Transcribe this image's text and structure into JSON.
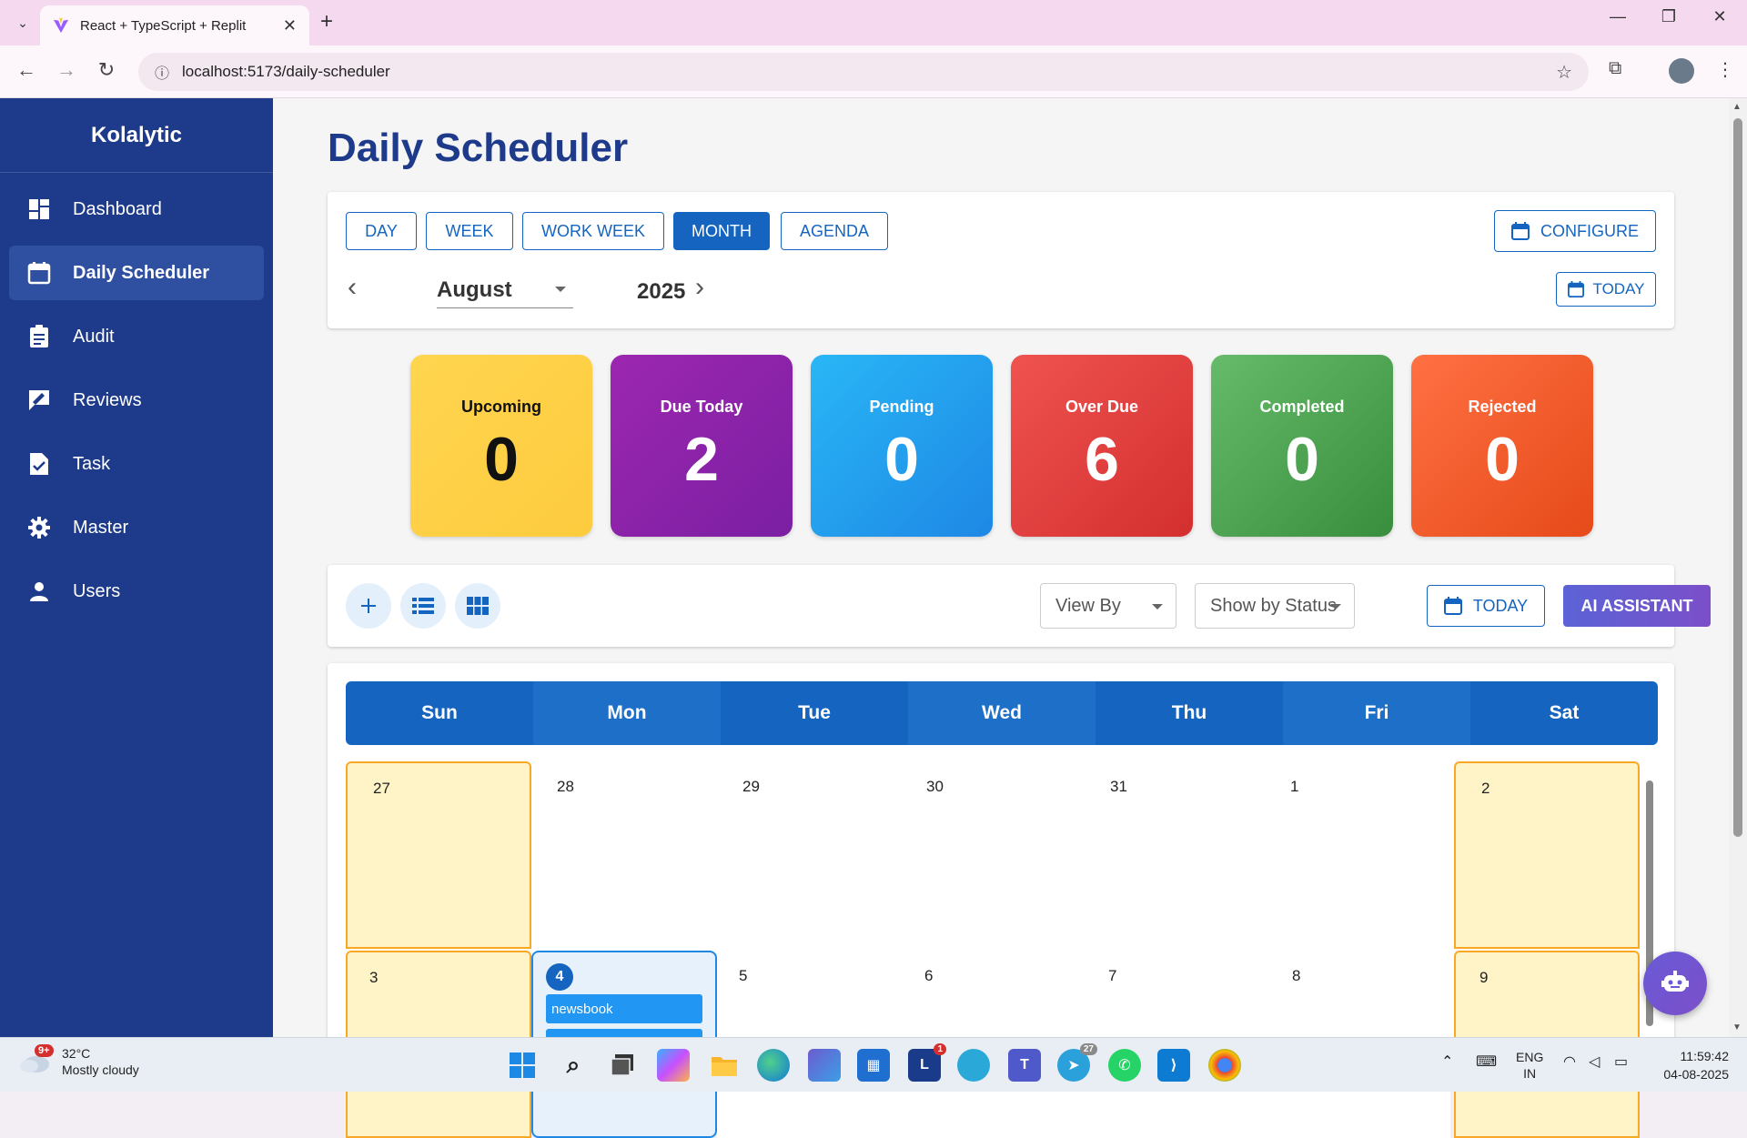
{
  "browser": {
    "tab_title": "React + TypeScript + Replit",
    "url": "localhost:5173/daily-scheduler"
  },
  "sidebar": {
    "brand": "Kolalytic",
    "items": [
      {
        "label": "Dashboard",
        "icon": "dashboard-icon"
      },
      {
        "label": "Daily Scheduler",
        "icon": "calendar-icon",
        "active": true
      },
      {
        "label": "Audit",
        "icon": "clipboard-icon"
      },
      {
        "label": "Reviews",
        "icon": "rate-review-icon"
      },
      {
        "label": "Task",
        "icon": "task-file-icon"
      },
      {
        "label": "Master",
        "icon": "gear-icon"
      },
      {
        "label": "Users",
        "icon": "person-icon"
      }
    ]
  },
  "page": {
    "title": "Daily Scheduler"
  },
  "view_tabs": [
    "DAY",
    "WEEK",
    "WORK WEEK",
    "MONTH",
    "AGENDA"
  ],
  "active_view": "MONTH",
  "configure_label": "CONFIGURE",
  "today_label": "TODAY",
  "month": "August",
  "year": "2025",
  "stats": [
    {
      "label": "Upcoming",
      "value": "0",
      "color": "#fdd14f"
    },
    {
      "label": "Due Today",
      "value": "2",
      "color": "#8e24aa"
    },
    {
      "label": "Pending",
      "value": "0",
      "color": "#1e88e5"
    },
    {
      "label": "Over Due",
      "value": "6",
      "color": "#e53935"
    },
    {
      "label": "Completed",
      "value": "0",
      "color": "#43a047"
    },
    {
      "label": "Rejected",
      "value": "0",
      "color": "#f4511e"
    }
  ],
  "filters": {
    "view_by": "View By",
    "status": "Show by Status",
    "today": "TODAY",
    "ai": "AI ASSISTANT"
  },
  "calendar": {
    "weekdays": [
      "Sun",
      "Mon",
      "Tue",
      "Wed",
      "Thu",
      "Fri",
      "Sat"
    ],
    "week1": [
      "27",
      "28",
      "29",
      "30",
      "31",
      "1",
      "2"
    ],
    "week2": [
      "3",
      "4",
      "5",
      "6",
      "7",
      "8",
      "9"
    ],
    "event": "newsbook"
  },
  "taskbar": {
    "badge": "9+",
    "temp": "32°C",
    "weather": "Mostly cloudy",
    "lang1": "ENG",
    "lang2": "IN",
    "time": "11:59:42",
    "date": "04-08-2025",
    "teams_badge": "1",
    "telegram_badge": "27"
  },
  "colors": {
    "sidebar": "#1e3a8a",
    "primary": "#1565c0"
  }
}
